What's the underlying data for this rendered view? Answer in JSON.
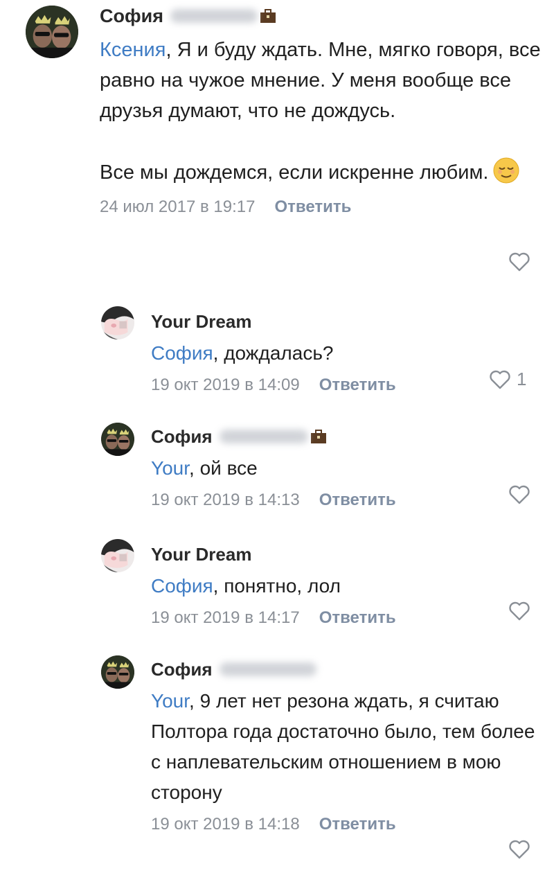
{
  "comments": [
    {
      "author": "София",
      "mention": "Ксения",
      "paragraphs": [
        ", Я и буду ждать. Мне, мягко говоря, все равно на чужое мнение. У меня вообще все друзья думают, что не дождусь.",
        "Все мы дождемся, если искренне любим."
      ],
      "emoji": "relieved-face-emoji",
      "date": "24 июл 2017 в 19:17",
      "reply_label": "Ответить",
      "likes": ""
    },
    {
      "author": "Your Dream",
      "mention": "София",
      "text": ", дождалась?",
      "date": "19 окт 2019 в 14:09",
      "reply_label": "Ответить",
      "likes": "1"
    },
    {
      "author": "София",
      "mention": "Your",
      "text": ", ой все",
      "date": "19 окт 2019 в 14:13",
      "reply_label": "Ответить",
      "likes": ""
    },
    {
      "author": "Your Dream",
      "mention": "София",
      "text": ", понятно, лол",
      "date": "19 окт 2019 в 14:17",
      "reply_label": "Ответить",
      "likes": ""
    },
    {
      "author": "София",
      "mention": "Your",
      "text": ", 9 лет нет резона ждать, я считаю",
      "text2": "Полтора года достаточно было, тем более с наплевательским отношением в мою сторону",
      "date": "19 окт 2019 в 14:18",
      "reply_label": "Ответить",
      "likes": ""
    }
  ],
  "icons": {
    "like": "heart-outline-icon",
    "badge": "briefcase-icon"
  },
  "colors": {
    "mention": "#3f7cc4",
    "meta": "#8a8f96",
    "reply_link": "#7f8ea3"
  }
}
